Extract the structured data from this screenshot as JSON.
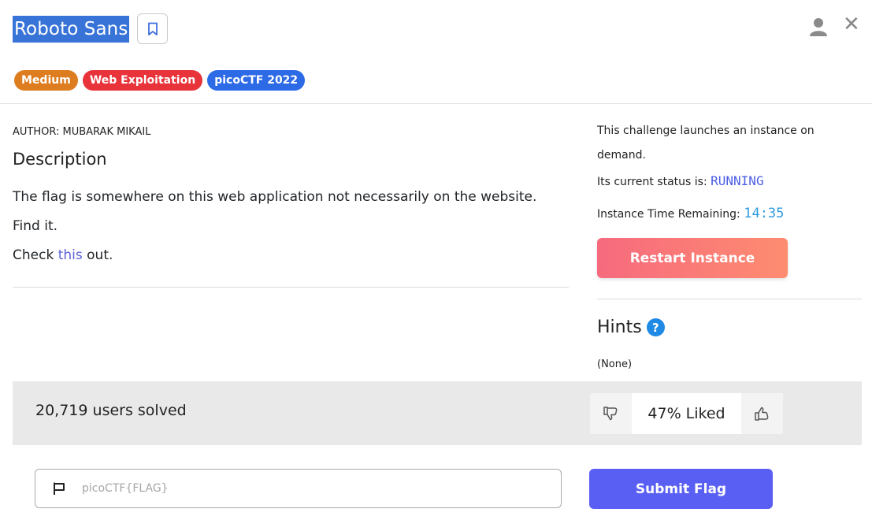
{
  "challenge": {
    "title": "Roboto Sans",
    "tags": [
      "Medium",
      "Web Exploitation",
      "picoCTF 2022"
    ],
    "author": "AUTHOR: MUBARAK MIKAIL"
  },
  "description": {
    "heading": "Description",
    "line1": "The flag is somewhere on this web application not necessarily on the website.",
    "line2": "Find it.",
    "line3_prefix": "Check ",
    "line3_link": "this",
    "line3_suffix": " out."
  },
  "instance": {
    "launch_line1": "This challenge launches an instance on",
    "launch_line2": "demand.",
    "status_label": "Its current status is: ",
    "status_value": "RUNNING",
    "time_label": "Instance Time Remaining: ",
    "time_value": "14:35",
    "restart_label": "Restart Instance"
  },
  "hints": {
    "heading": "Hints",
    "help_glyph": "?",
    "value": "(None)"
  },
  "stats": {
    "solved": "20,719 users solved",
    "liked": "47% Liked"
  },
  "flag_form": {
    "placeholder": "picoCTF{FLAG}",
    "submit_label": "Submit Flag"
  },
  "icons": {
    "bookmark": "bookmark-icon",
    "user": "user-icon",
    "close": "close-icon",
    "thumbs_down": "thumbs-down-icon",
    "thumbs_up": "thumbs-up-icon",
    "flag": "flag-icon"
  },
  "colors": {
    "title_highlight": "#3874d8",
    "tag_medium": "#dd7d1f",
    "tag_web": "#e8333b",
    "tag_pico": "#2d6ae6",
    "status": "#4a5de2",
    "timer": "#2e9be0",
    "restart_start": "#f76a7e",
    "restart_end": "#fd8c70",
    "submit": "#5a5ff3"
  }
}
